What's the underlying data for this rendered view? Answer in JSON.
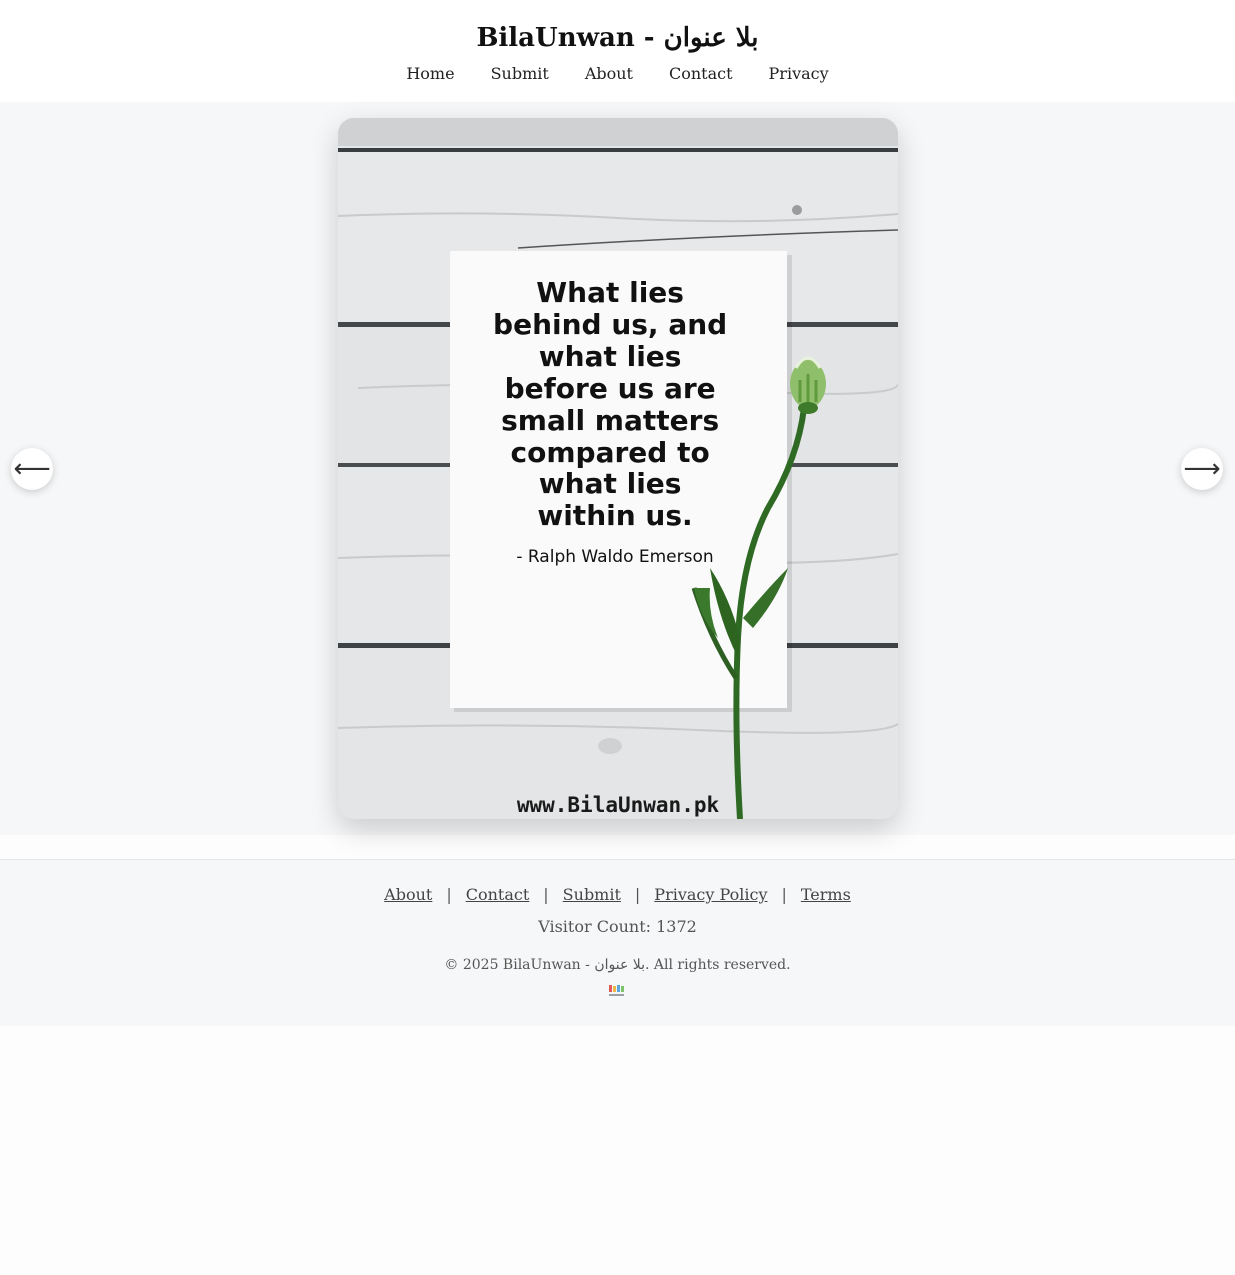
{
  "site": {
    "title": "BilaUnwan - بلا عنوان"
  },
  "nav": {
    "items": [
      "Home",
      "Submit",
      "About",
      "Contact",
      "Privacy"
    ]
  },
  "gallery": {
    "prev_icon": "arrow-left-icon",
    "next_icon": "arrow-right-icon",
    "prev_glyph": "⟵",
    "next_glyph": "⟶",
    "image": {
      "quote_lines": [
        "What lies",
        "behind us, and",
        "what lies",
        "before us are",
        "small matters",
        "compared to",
        "what lies",
        "within us."
      ],
      "author": "- Ralph Waldo Emerson",
      "watermark": "www.BilaUnwan.pk"
    }
  },
  "footer": {
    "links": [
      "About",
      "Contact",
      "Submit",
      "Privacy Policy",
      "Terms"
    ],
    "separator": "|",
    "visitor_count": "Visitor Count: 1372",
    "copyright": "© 2025 BilaUnwan - بلا عنوان. All rights reserved.",
    "logo_text": "BILA UNWAN"
  },
  "colors": {
    "header_bg": "#ffffff",
    "gallery_bg": "#f6f7f8",
    "footer_bg": "#f6f7f8",
    "link": "#444444"
  }
}
